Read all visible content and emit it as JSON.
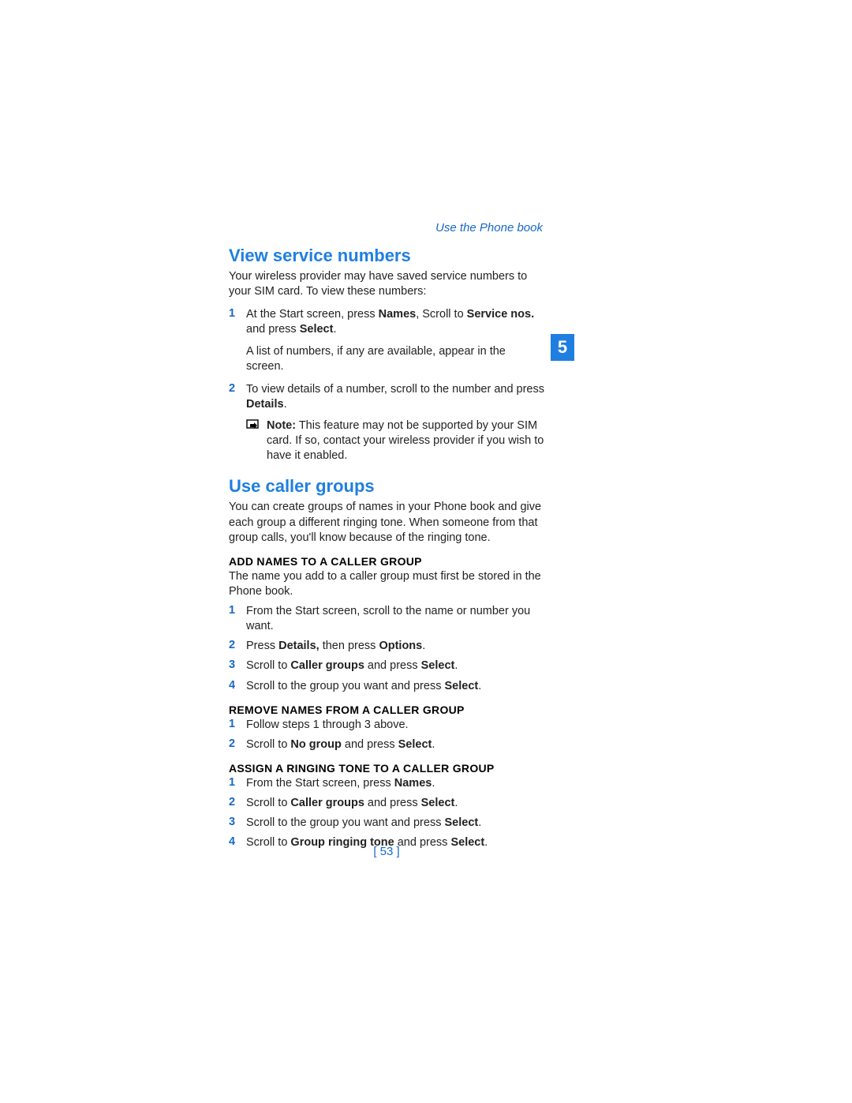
{
  "header": {
    "breadcrumb": "Use the Phone book",
    "chapter_number": "5"
  },
  "section1": {
    "title": "View service numbers",
    "intro": "Your wireless provider may have saved service numbers to your SIM card. To view these numbers:",
    "step1_num": "1",
    "step1_a": "At the Start screen, press ",
    "step1_b": "Names",
    "step1_c": ", Scroll to ",
    "step1_d": "Service nos.",
    "step1_e": " and press ",
    "step1_f": "Select",
    "step1_g": ".",
    "step1_after": "A list of numbers, if any are available, appear in the screen.",
    "step2_num": "2",
    "step2_a": "To view details of a number, scroll to the number and press ",
    "step2_b": "Details",
    "step2_c": ".",
    "note_label": "Note:",
    "note_text": " This feature may not be supported by your SIM card. If so, contact your wireless provider if you wish to have it enabled."
  },
  "section2": {
    "title": "Use caller groups",
    "intro": "You can create groups of names in your Phone book and give each group a different ringing tone. When someone from that group calls, you'll know because of the ringing tone.",
    "sub1": {
      "title": "ADD NAMES TO A CALLER GROUP",
      "intro": "The name you add to a caller group must first be stored in the Phone book.",
      "s1_num": "1",
      "s1": "From the Start screen, scroll to the name or number you want.",
      "s2_num": "2",
      "s2_a": "Press ",
      "s2_b": "Details,",
      "s2_c": " then press ",
      "s2_d": "Options",
      "s2_e": ".",
      "s3_num": "3",
      "s3_a": "Scroll to ",
      "s3_b": "Caller groups",
      "s3_c": " and press ",
      "s3_d": "Select",
      "s3_e": ".",
      "s4_num": "4",
      "s4_a": "Scroll to the group you want and press ",
      "s4_b": "Select",
      "s4_c": "."
    },
    "sub2": {
      "title": "REMOVE NAMES FROM A CALLER GROUP",
      "s1_num": "1",
      "s1": "Follow steps 1 through 3 above.",
      "s2_num": "2",
      "s2_a": "Scroll to ",
      "s2_b": "No group",
      "s2_c": " and press ",
      "s2_d": "Select",
      "s2_e": "."
    },
    "sub3": {
      "title": "ASSIGN A RINGING TONE TO A CALLER GROUP",
      "s1_num": "1",
      "s1_a": "From the Start screen, press ",
      "s1_b": "Names",
      "s1_c": ".",
      "s2_num": "2",
      "s2_a": "Scroll to ",
      "s2_b": "Caller groups",
      "s2_c": " and press ",
      "s2_d": "Select",
      "s2_e": ".",
      "s3_num": "3",
      "s3_a": "Scroll to the group you want and press ",
      "s3_b": "Select",
      "s3_c": ".",
      "s4_num": "4",
      "s4_a": "Scroll to ",
      "s4_b": "Group ringing tone",
      "s4_c": " and press ",
      "s4_d": "Select",
      "s4_e": "."
    }
  },
  "footer": {
    "page": "[ 53 ]"
  }
}
